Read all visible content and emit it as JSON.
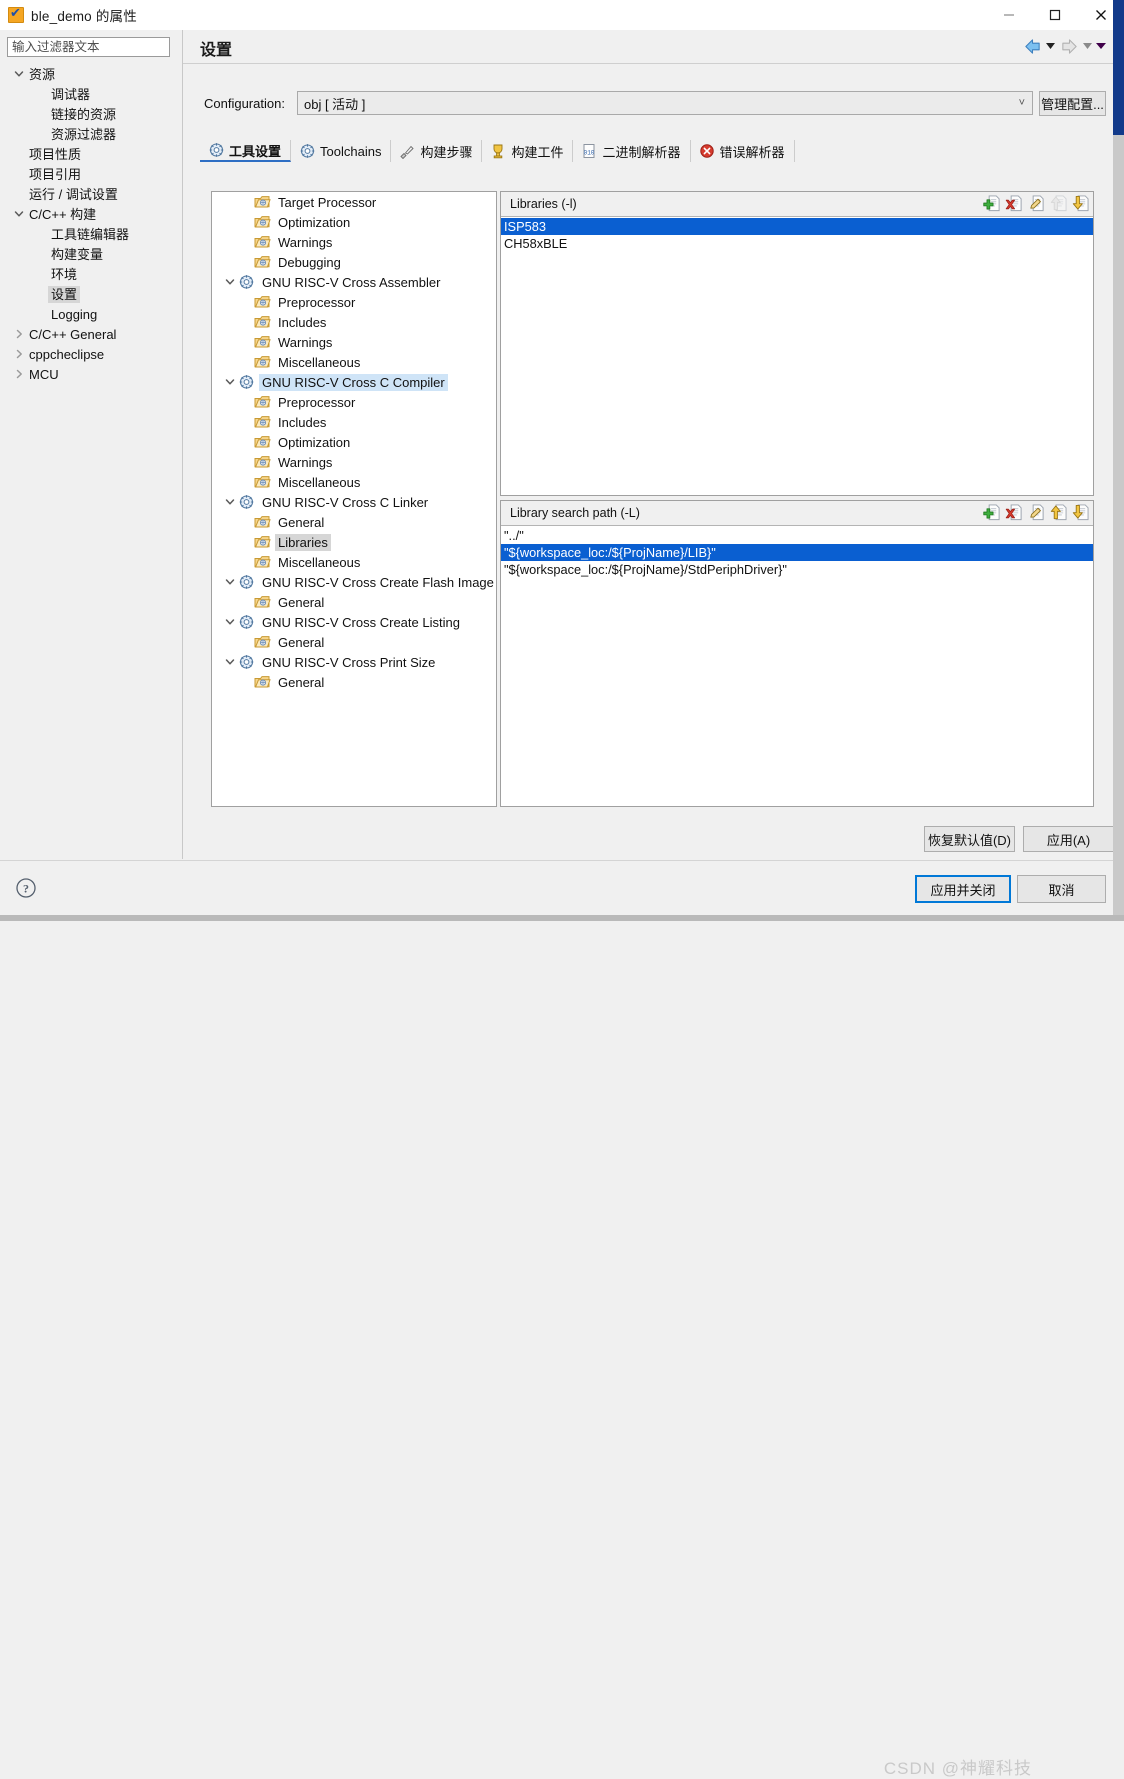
{
  "window": {
    "title": "ble_demo 的属性",
    "icon": "project-properties-icon",
    "minimize_label": "最小化",
    "maximize_label": "最大化",
    "close_label": "关闭"
  },
  "sidebar": {
    "filter_placeholder": "输入过滤器文本",
    "filter_value": "",
    "items": [
      {
        "label": "资源",
        "indent": 0,
        "twisty": "down",
        "selected": false
      },
      {
        "label": "调试器",
        "indent": 1,
        "twisty": "none",
        "selected": false
      },
      {
        "label": "链接的资源",
        "indent": 1,
        "twisty": "none",
        "selected": false
      },
      {
        "label": "资源过滤器",
        "indent": 1,
        "twisty": "none",
        "selected": false
      },
      {
        "label": "项目性质",
        "indent": 0,
        "twisty": "none",
        "selected": false
      },
      {
        "label": "项目引用",
        "indent": 0,
        "twisty": "none",
        "selected": false
      },
      {
        "label": "运行 / 调试设置",
        "indent": 0,
        "twisty": "none",
        "selected": false
      },
      {
        "label": "C/C++ 构建",
        "indent": 0,
        "twisty": "down",
        "selected": false
      },
      {
        "label": "工具链编辑器",
        "indent": 1,
        "twisty": "none",
        "selected": false
      },
      {
        "label": "构建变量",
        "indent": 1,
        "twisty": "none",
        "selected": false
      },
      {
        "label": "环境",
        "indent": 1,
        "twisty": "none",
        "selected": false
      },
      {
        "label": "设置",
        "indent": 1,
        "twisty": "none",
        "selected": true
      },
      {
        "label": "Logging",
        "indent": 1,
        "twisty": "none",
        "selected": false
      },
      {
        "label": "C/C++ General",
        "indent": 0,
        "twisty": "right",
        "selected": false
      },
      {
        "label": "cppcheclipse",
        "indent": 0,
        "twisty": "right",
        "selected": false
      },
      {
        "label": "MCU",
        "indent": 0,
        "twisty": "right",
        "selected": false
      }
    ]
  },
  "page": {
    "title": "设置",
    "nav": {
      "back_icon": "back-arrow-icon",
      "back_menu_icon": "chevron-down-icon",
      "forward_icon": "forward-arrow-icon",
      "forward_menu_icon": "chevron-down-icon",
      "view_menu_icon": "chevron-down-icon"
    }
  },
  "configuration": {
    "label": "Configuration:",
    "value": "obj  [ 活动 ]",
    "dropdown_icon": "chevron-down-icon",
    "manage_button": "管理配置..."
  },
  "tabs": [
    {
      "label": "工具设置",
      "icon": "tool-settings-icon",
      "active": true
    },
    {
      "label": "Toolchains",
      "icon": "toolchain-icon",
      "active": false
    },
    {
      "label": "构建步骤",
      "icon": "build-steps-icon",
      "active": false
    },
    {
      "label": "构建工件",
      "icon": "build-artifact-icon",
      "active": false
    },
    {
      "label": "二进制解析器",
      "icon": "binary-parser-icon",
      "active": false
    },
    {
      "label": "错误解析器",
      "icon": "error-parser-icon",
      "active": false
    }
  ],
  "tool_tree": [
    {
      "label": "Target Processor",
      "indent": 1,
      "twisty": "none",
      "icon": "folder-tool-icon",
      "state": "none"
    },
    {
      "label": "Optimization",
      "indent": 1,
      "twisty": "none",
      "icon": "folder-tool-icon",
      "state": "none"
    },
    {
      "label": "Warnings",
      "indent": 1,
      "twisty": "none",
      "icon": "folder-tool-icon",
      "state": "none"
    },
    {
      "label": "Debugging",
      "indent": 1,
      "twisty": "none",
      "icon": "folder-tool-icon",
      "state": "none"
    },
    {
      "label": "GNU RISC-V Cross Assembler",
      "indent": 0,
      "twisty": "down",
      "icon": "gear-tool-icon",
      "state": "none"
    },
    {
      "label": "Preprocessor",
      "indent": 1,
      "twisty": "none",
      "icon": "folder-tool-icon",
      "state": "none"
    },
    {
      "label": "Includes",
      "indent": 1,
      "twisty": "none",
      "icon": "folder-tool-icon",
      "state": "none"
    },
    {
      "label": "Warnings",
      "indent": 1,
      "twisty": "none",
      "icon": "folder-tool-icon",
      "state": "none"
    },
    {
      "label": "Miscellaneous",
      "indent": 1,
      "twisty": "none",
      "icon": "folder-tool-icon",
      "state": "none"
    },
    {
      "label": "GNU RISC-V Cross C Compiler",
      "indent": 0,
      "twisty": "down",
      "icon": "gear-tool-icon",
      "state": "blue"
    },
    {
      "label": "Preprocessor",
      "indent": 1,
      "twisty": "none",
      "icon": "folder-tool-icon",
      "state": "none"
    },
    {
      "label": "Includes",
      "indent": 1,
      "twisty": "none",
      "icon": "folder-tool-icon",
      "state": "none"
    },
    {
      "label": "Optimization",
      "indent": 1,
      "twisty": "none",
      "icon": "folder-tool-icon",
      "state": "none"
    },
    {
      "label": "Warnings",
      "indent": 1,
      "twisty": "none",
      "icon": "folder-tool-icon",
      "state": "none"
    },
    {
      "label": "Miscellaneous",
      "indent": 1,
      "twisty": "none",
      "icon": "folder-tool-icon",
      "state": "none"
    },
    {
      "label": "GNU RISC-V Cross C Linker",
      "indent": 0,
      "twisty": "down",
      "icon": "gear-tool-icon",
      "state": "none"
    },
    {
      "label": "General",
      "indent": 1,
      "twisty": "none",
      "icon": "folder-tool-icon",
      "state": "none"
    },
    {
      "label": "Libraries",
      "indent": 1,
      "twisty": "none",
      "icon": "folder-tool-icon",
      "state": "grey"
    },
    {
      "label": "Miscellaneous",
      "indent": 1,
      "twisty": "none",
      "icon": "folder-tool-icon",
      "state": "none"
    },
    {
      "label": "GNU RISC-V Cross Create Flash Image",
      "indent": 0,
      "twisty": "down",
      "icon": "gear-tool-icon",
      "state": "none"
    },
    {
      "label": "General",
      "indent": 1,
      "twisty": "none",
      "icon": "folder-tool-icon",
      "state": "none"
    },
    {
      "label": "GNU RISC-V Cross Create Listing",
      "indent": 0,
      "twisty": "down",
      "icon": "gear-tool-icon",
      "state": "none"
    },
    {
      "label": "General",
      "indent": 1,
      "twisty": "none",
      "icon": "folder-tool-icon",
      "state": "none"
    },
    {
      "label": "GNU RISC-V Cross Print Size",
      "indent": 0,
      "twisty": "down",
      "icon": "gear-tool-icon",
      "state": "none"
    },
    {
      "label": "General",
      "indent": 1,
      "twisty": "none",
      "icon": "folder-tool-icon",
      "state": "none"
    }
  ],
  "libraries_panel": {
    "title": "Libraries (-l)",
    "tools": [
      {
        "name": "add-icon",
        "enabled": true
      },
      {
        "name": "delete-icon",
        "enabled": true
      },
      {
        "name": "edit-icon",
        "enabled": true
      },
      {
        "name": "move-up-icon",
        "enabled": false
      },
      {
        "name": "move-down-icon",
        "enabled": true
      }
    ],
    "rows": [
      {
        "text": "ISP583",
        "selected": true
      },
      {
        "text": "CH58xBLE",
        "selected": false
      }
    ]
  },
  "search_path_panel": {
    "title": "Library search path (-L)",
    "tools": [
      {
        "name": "add-icon",
        "enabled": true
      },
      {
        "name": "delete-icon",
        "enabled": true
      },
      {
        "name": "edit-icon",
        "enabled": true
      },
      {
        "name": "move-up-icon",
        "enabled": true
      },
      {
        "name": "move-down-icon",
        "enabled": true
      }
    ],
    "rows": [
      {
        "text": "\"../\"",
        "selected": false
      },
      {
        "text": "\"${workspace_loc:/${ProjName}/LIB}\"",
        "selected": true
      },
      {
        "text": "\"${workspace_loc:/${ProjName}/StdPeriphDriver}\"",
        "selected": false
      }
    ]
  },
  "buttons": {
    "restore_defaults": "恢复默认值(D)",
    "apply": "应用(A)",
    "apply_and_close": "应用并关闭",
    "cancel": "取消",
    "help_icon": "help-icon"
  },
  "watermark": "CSDN @神耀科技",
  "colors": {
    "selection_blue": "#0a5fd1",
    "tree_selection": "#cfe4f7",
    "focus_border": "#0078d7",
    "accent_edge": "#123a8a"
  }
}
